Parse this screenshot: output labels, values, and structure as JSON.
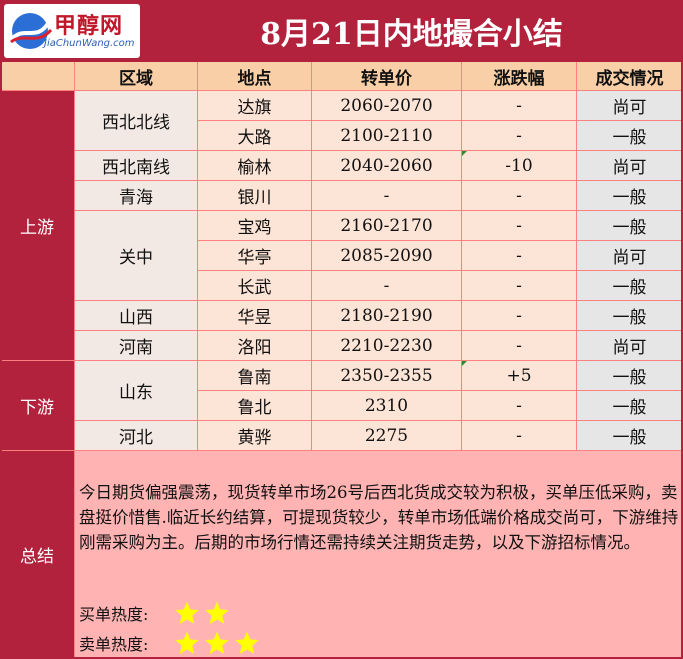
{
  "title": "8月21日内地撮合小结",
  "logo": {
    "name": "甲醇网",
    "url": "JiaChunWang.com"
  },
  "headers": [
    "区域",
    "地点",
    "转单价",
    "涨跌幅",
    "成交情况"
  ],
  "sections": {
    "upstream": "上游",
    "downstream": "下游",
    "summary": "总结"
  },
  "rows": [
    {
      "region": "西北北线",
      "place": "达旗",
      "price": "2060-2070",
      "change": "-",
      "deal": "尚可"
    },
    {
      "region": "西北北线",
      "place": "大路",
      "price": "2100-2110",
      "change": "-",
      "deal": "一般"
    },
    {
      "region": "西北南线",
      "place": "榆林",
      "price": "2040-2060",
      "change": "-10",
      "deal": "尚可"
    },
    {
      "region": "青海",
      "place": "银川",
      "price": "-",
      "change": "-",
      "deal": "一般"
    },
    {
      "region": "关中",
      "place": "宝鸡",
      "price": "2160-2170",
      "change": "-",
      "deal": "一般"
    },
    {
      "region": "关中",
      "place": "华亭",
      "price": "2085-2090",
      "change": "-",
      "deal": "尚可"
    },
    {
      "region": "关中",
      "place": "长武",
      "price": "-",
      "change": "-",
      "deal": "一般"
    },
    {
      "region": "山西",
      "place": "华昱",
      "price": "2180-2190",
      "change": "-",
      "deal": "一般"
    },
    {
      "region": "河南",
      "place": "洛阳",
      "price": "2210-2230",
      "change": "-",
      "deal": "尚可"
    },
    {
      "region": "山东",
      "place": "鲁南",
      "price": "2350-2355",
      "change": "+5",
      "deal": "一般"
    },
    {
      "region": "山东",
      "place": "鲁北",
      "price": "2310",
      "change": "-",
      "deal": "一般"
    },
    {
      "region": "河北",
      "place": "黄骅",
      "price": "2275",
      "change": "-",
      "deal": "一般"
    }
  ],
  "summary": "今日期货偏强震荡，现货转单市场26号后西北货成交较为积极，买单压低采购，卖盘挺价惜售.临近长约结算，可提现货较少，转单市场低端价格成交尚可，下游维持刚需采购为主。后期的市场行情还需持续关注期货走势，以及下游招标情况。",
  "buy_heat": {
    "label": "买单热度:",
    "stars": 2
  },
  "sell_heat": {
    "label": "卖单热度:",
    "stars": 3
  },
  "colors": {
    "title_bg": "#b3223d",
    "header_bg": "#f9cfa8",
    "peach": "#fce4d6",
    "gray": "#e6e6e6",
    "border": "#ff8080",
    "star": "#ffff00"
  }
}
